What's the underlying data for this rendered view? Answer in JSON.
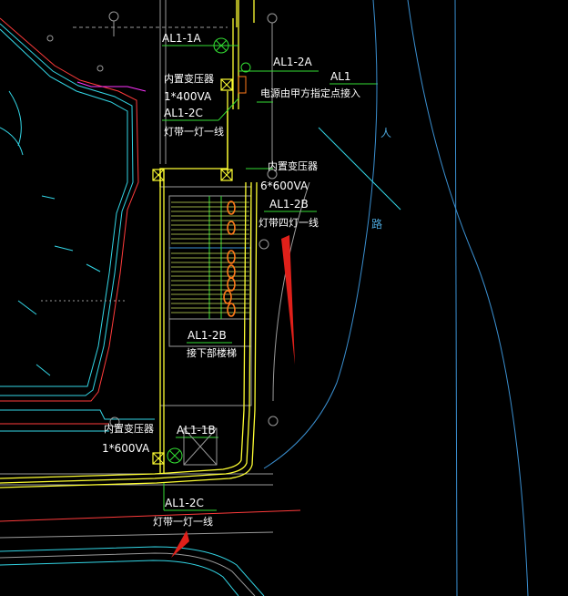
{
  "drawing": {
    "background": "#000000",
    "labels": {
      "al1_1a": "AL1-1A",
      "al1_2a": "AL1-2A",
      "al1": "AL1",
      "transformer_top": "内置变压器",
      "power_note": "电源由甲方指定点接入",
      "va_1x400": "1*400VA",
      "al1_2c_top": "AL1-2C",
      "strip_one_top": "灯带一灯一线",
      "transformer_right": "内置变压器",
      "va_6x600": "6*600VA",
      "al1_2b_right": "AL1-2B",
      "strip_four": "灯带四灯一线",
      "al1_2b_stair": "AL1-2B",
      "stair_note": "接下部楼梯",
      "transformer_bottom": "内置变压器",
      "al1_1b": "AL1-1B",
      "va_1x600": "1*600VA",
      "al1_2c_bottom": "AL1-2C",
      "strip_one_bottom": "灯带一灯一线",
      "road_char_1": "人",
      "road_char_2": "路"
    },
    "colors": {
      "yellow": "#ffff33",
      "green": "#33dd33",
      "cyan": "#33d6e6",
      "magenta": "#ff33ff",
      "red": "#ff3b3b",
      "orange": "#ff7a1a",
      "gray": "#9a9a9a",
      "blue": "#3a8fd0",
      "arrow_red": "#e0201a"
    }
  }
}
